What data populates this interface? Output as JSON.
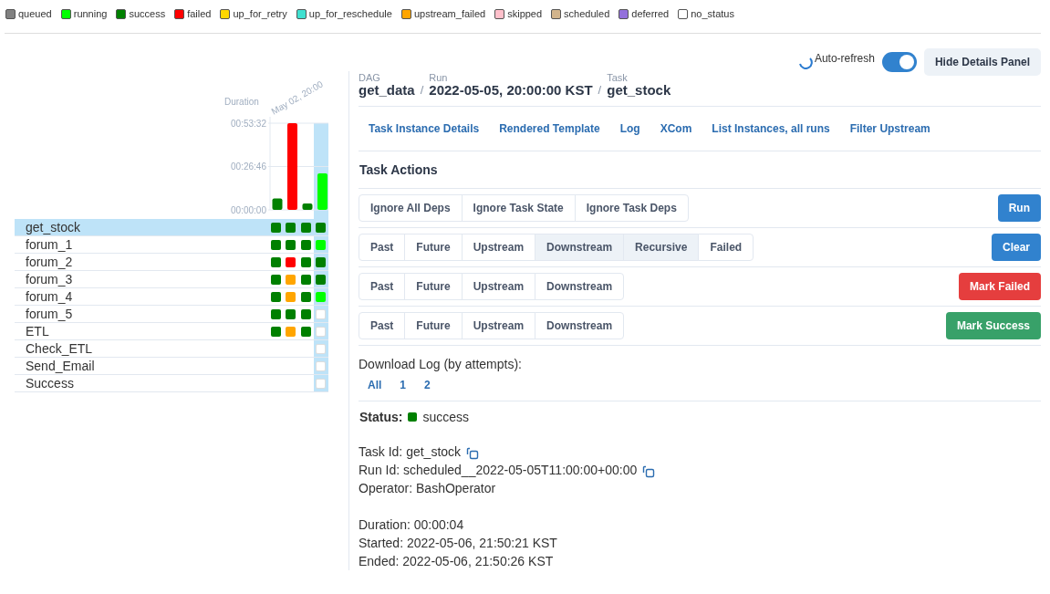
{
  "legend": [
    {
      "label": "queued",
      "color": "#808080"
    },
    {
      "label": "running",
      "color": "#00ff00"
    },
    {
      "label": "success",
      "color": "#008000"
    },
    {
      "label": "failed",
      "color": "#ff0000"
    },
    {
      "label": "up_for_retry",
      "color": "#ffd700"
    },
    {
      "label": "up_for_reschedule",
      "color": "#40e0d0"
    },
    {
      "label": "upstream_failed",
      "color": "#ffa500"
    },
    {
      "label": "skipped",
      "color": "#ffc0cb"
    },
    {
      "label": "scheduled",
      "color": "#d2b48c"
    },
    {
      "label": "deferred",
      "color": "#9370db"
    },
    {
      "label": "no_status",
      "color": "#ffffff"
    }
  ],
  "toolbar": {
    "auto_refresh_label": "Auto-refresh",
    "auto_refresh_on": true,
    "hide_button": "Hide Details Panel"
  },
  "grid": {
    "run_label": "May 02, 20:00",
    "runs": [
      {
        "selected": false,
        "color": "#008000"
      },
      {
        "selected": false,
        "color": "#ff0000"
      },
      {
        "selected": false,
        "color": "#008000"
      },
      {
        "selected": true,
        "color": "#00ff00"
      }
    ],
    "chart_data": {
      "type": "bar",
      "ylabel": "Duration",
      "values": [
        7,
        53.5,
        4,
        22.5
      ],
      "ylim": [
        0,
        53.53
      ],
      "yticks": [
        {
          "value": 0,
          "label": "00:00:00"
        },
        {
          "value": 26.77,
          "label": "00:26:46"
        },
        {
          "value": 53.53,
          "label": "00:53:32"
        }
      ]
    },
    "tasks": [
      {
        "name": "get_stock",
        "selected": true,
        "instances": [
          {
            "color": "#008000"
          },
          {
            "color": "#008000"
          },
          {
            "color": "#008000"
          },
          {
            "color": "#008000"
          }
        ]
      },
      {
        "name": "forum_1",
        "selected": false,
        "instances": [
          {
            "color": "#008000"
          },
          {
            "color": "#008000"
          },
          {
            "color": "#008000"
          },
          {
            "color": "#00ff00"
          }
        ]
      },
      {
        "name": "forum_2",
        "selected": false,
        "instances": [
          {
            "color": "#008000"
          },
          {
            "color": "#ff0000"
          },
          {
            "color": "#008000"
          },
          {
            "color": "#008000"
          }
        ]
      },
      {
        "name": "forum_3",
        "selected": false,
        "instances": [
          {
            "color": "#008000"
          },
          {
            "color": "#ffa500"
          },
          {
            "color": "#008000"
          },
          {
            "color": "#008000"
          }
        ]
      },
      {
        "name": "forum_4",
        "selected": false,
        "instances": [
          {
            "color": "#008000"
          },
          {
            "color": "#ffa500"
          },
          {
            "color": "#008000"
          },
          {
            "color": "#00ff00"
          }
        ]
      },
      {
        "name": "forum_5",
        "selected": false,
        "instances": [
          {
            "color": "#008000"
          },
          {
            "color": "#008000"
          },
          {
            "color": "#008000"
          },
          {
            "color": "#ffffff"
          }
        ]
      },
      {
        "name": "ETL",
        "selected": false,
        "instances": [
          {
            "color": "#008000"
          },
          {
            "color": "#ffa500"
          },
          {
            "color": "#008000"
          },
          {
            "color": "#ffffff"
          }
        ]
      },
      {
        "name": "Check_ETL",
        "selected": false,
        "instances": [
          {
            "color": "#ffffff"
          }
        ]
      },
      {
        "name": "Send_Email",
        "selected": false,
        "instances": [
          {
            "color": "#ffffff"
          }
        ]
      },
      {
        "name": "Success",
        "selected": false,
        "instances": [
          {
            "color": "#ffffff"
          }
        ]
      }
    ]
  },
  "breadcrumb_separator": "/",
  "breadcrumb": [
    {
      "caption": "DAG",
      "value": "get_data"
    },
    {
      "caption": "Run",
      "value": "2022-05-05, 20:00:00 KST"
    },
    {
      "caption": "Task",
      "value": "get_stock"
    }
  ],
  "tabs": [
    "Task Instance Details",
    "Rendered Template",
    "Log",
    "XCom",
    "List Instances, all runs",
    "Filter Upstream"
  ],
  "actions_title": "Task Actions",
  "actions": [
    {
      "options": [
        {
          "label": "Ignore All Deps",
          "selected": false
        },
        {
          "label": "Ignore Task State",
          "selected": false
        },
        {
          "label": "Ignore Task Deps",
          "selected": false
        }
      ],
      "button": "Run",
      "kind": "run"
    },
    {
      "options": [
        {
          "label": "Past",
          "selected": false
        },
        {
          "label": "Future",
          "selected": false
        },
        {
          "label": "Upstream",
          "selected": false
        },
        {
          "label": "Downstream",
          "selected": true
        },
        {
          "label": "Recursive",
          "selected": true
        },
        {
          "label": "Failed",
          "selected": false
        }
      ],
      "button": "Clear",
      "kind": "clear"
    },
    {
      "options": [
        {
          "label": "Past",
          "selected": false
        },
        {
          "label": "Future",
          "selected": false
        },
        {
          "label": "Upstream",
          "selected": false
        },
        {
          "label": "Downstream",
          "selected": false
        }
      ],
      "button": "Mark Failed",
      "kind": "failed"
    },
    {
      "options": [
        {
          "label": "Past",
          "selected": false
        },
        {
          "label": "Future",
          "selected": false
        },
        {
          "label": "Upstream",
          "selected": false
        },
        {
          "label": "Downstream",
          "selected": false
        }
      ],
      "button": "Mark Success",
      "kind": "success"
    }
  ],
  "download_log": {
    "label": "Download Log (by attempts):",
    "links": [
      "All",
      "1",
      "2"
    ]
  },
  "status": {
    "label": "Status:",
    "value": "success",
    "color": "#008000"
  },
  "details": [
    {
      "text": "Task Id: get_stock",
      "copy": true
    },
    {
      "text": "Run Id: scheduled__2022-05-05T11:00:00+00:00",
      "copy": true
    },
    {
      "text": "Operator: BashOperator",
      "copy": false
    }
  ],
  "timing": [
    "Duration: 00:00:04",
    "Started: 2022-05-06, 21:50:21 KST",
    "Ended: 2022-05-06, 21:50:26 KST"
  ]
}
